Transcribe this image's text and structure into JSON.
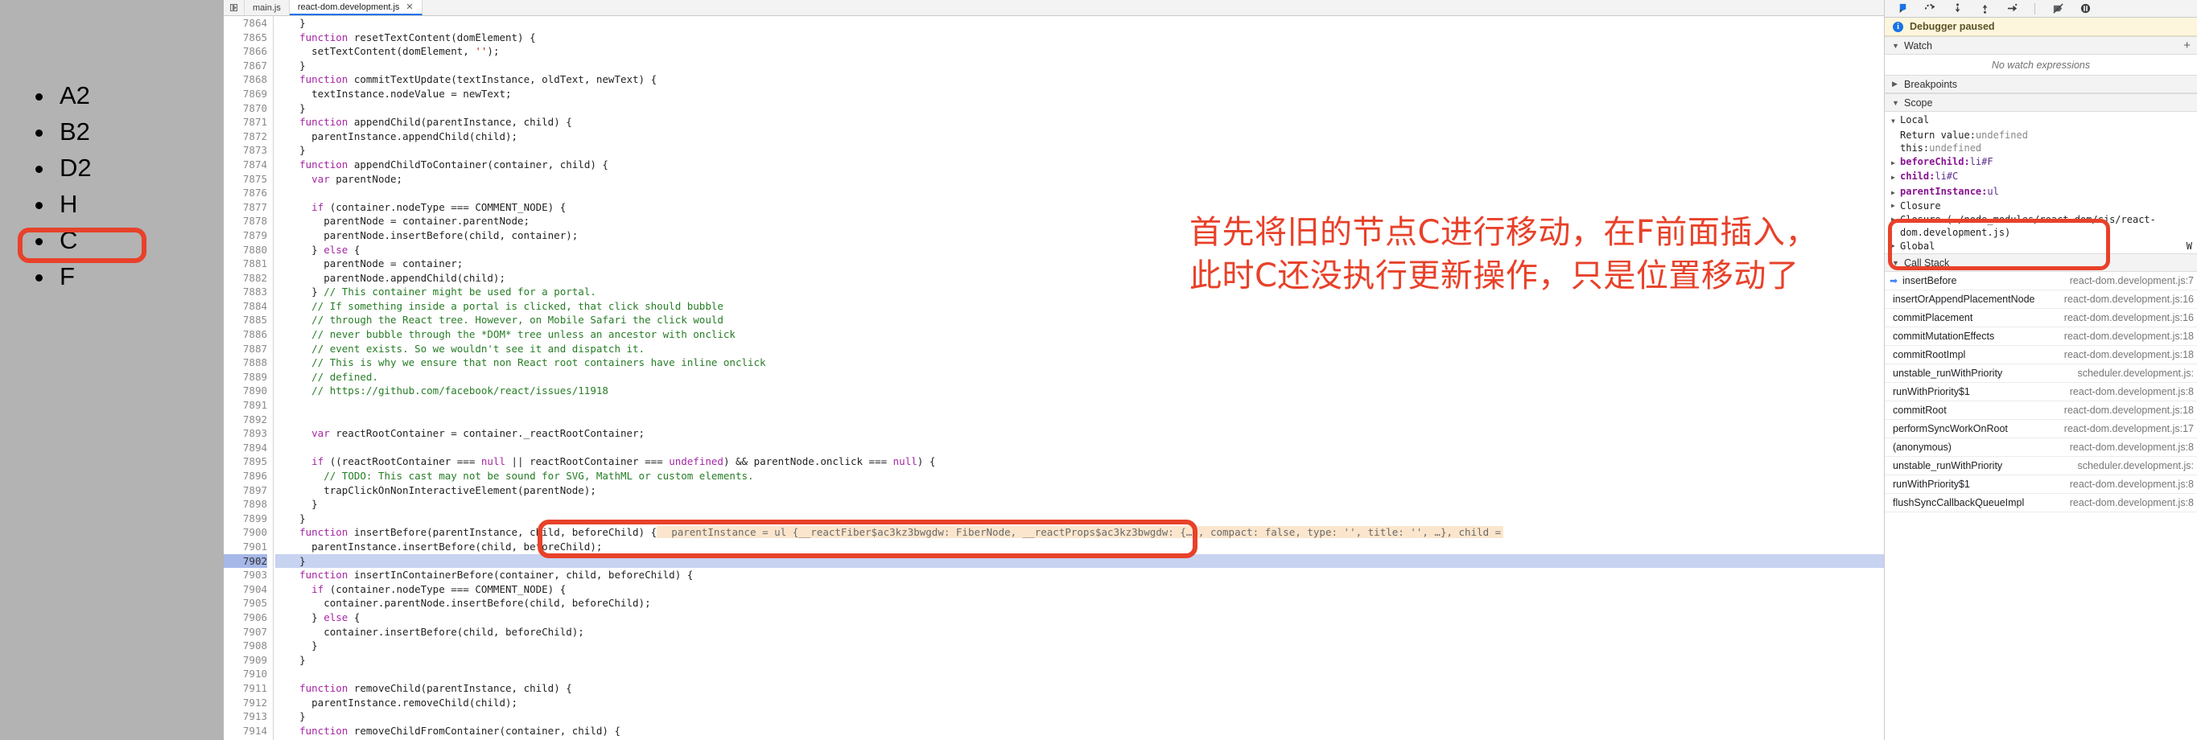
{
  "rendered_page": {
    "list_items": [
      {
        "label": "A2",
        "highlighted": false
      },
      {
        "label": "B2",
        "highlighted": false
      },
      {
        "label": "D2",
        "highlighted": false
      },
      {
        "label": "H",
        "highlighted": false
      },
      {
        "label": "C",
        "highlighted": true
      },
      {
        "label": "F",
        "highlighted": false
      }
    ]
  },
  "annotation": {
    "text": "首先将旧的节点C进行移动，在F前面插入，\n此时C还没执行更新操作，只是位置移动了",
    "color": "#e8412a"
  },
  "tabs": {
    "items": [
      {
        "label": "main.js",
        "active": false,
        "closable": false
      },
      {
        "label": "react-dom.development.js",
        "active": true,
        "closable": true
      }
    ],
    "close_glyph": "✕"
  },
  "editor": {
    "first_line": 7864,
    "current_line": 7902,
    "inline_eval": "parentInstance = ul {__reactFiber$ac3kz3bwgdw: FiberNode, __reactProps$ac3kz3bwgdw: {…}, compact: false, type: '', title: '', …}, child =",
    "lines": [
      {
        "n": 7864,
        "text": "    }"
      },
      {
        "n": 7865,
        "text": "    function resetTextContent(domElement) {"
      },
      {
        "n": 7866,
        "text": "      setTextContent(domElement, '');"
      },
      {
        "n": 7867,
        "text": "    }"
      },
      {
        "n": 7868,
        "text": "    function commitTextUpdate(textInstance, oldText, newText) {"
      },
      {
        "n": 7869,
        "text": "      textInstance.nodeValue = newText;"
      },
      {
        "n": 7870,
        "text": "    }"
      },
      {
        "n": 7871,
        "text": "    function appendChild(parentInstance, child) {"
      },
      {
        "n": 7872,
        "text": "      parentInstance.appendChild(child);"
      },
      {
        "n": 7873,
        "text": "    }"
      },
      {
        "n": 7874,
        "text": "    function appendChildToContainer(container, child) {"
      },
      {
        "n": 7875,
        "text": "      var parentNode;"
      },
      {
        "n": 7876,
        "text": ""
      },
      {
        "n": 7877,
        "text": "      if (container.nodeType === COMMENT_NODE) {"
      },
      {
        "n": 7878,
        "text": "        parentNode = container.parentNode;"
      },
      {
        "n": 7879,
        "text": "        parentNode.insertBefore(child, container);"
      },
      {
        "n": 7880,
        "text": "      } else {"
      },
      {
        "n": 7881,
        "text": "        parentNode = container;"
      },
      {
        "n": 7882,
        "text": "        parentNode.appendChild(child);"
      },
      {
        "n": 7883,
        "text": "      } // This container might be used for a portal."
      },
      {
        "n": 7884,
        "text": "      // If something inside a portal is clicked, that click should bubble"
      },
      {
        "n": 7885,
        "text": "      // through the React tree. However, on Mobile Safari the click would"
      },
      {
        "n": 7886,
        "text": "      // never bubble through the *DOM* tree unless an ancestor with onclick"
      },
      {
        "n": 7887,
        "text": "      // event exists. So we wouldn't see it and dispatch it."
      },
      {
        "n": 7888,
        "text": "      // This is why we ensure that non React root containers have inline onclick"
      },
      {
        "n": 7889,
        "text": "      // defined."
      },
      {
        "n": 7890,
        "text": "      // https://github.com/facebook/react/issues/11918"
      },
      {
        "n": 7891,
        "text": ""
      },
      {
        "n": 7892,
        "text": ""
      },
      {
        "n": 7893,
        "text": "      var reactRootContainer = container._reactRootContainer;"
      },
      {
        "n": 7894,
        "text": ""
      },
      {
        "n": 7895,
        "text": "      if ((reactRootContainer === null || reactRootContainer === undefined) && parentNode.onclick === null) {"
      },
      {
        "n": 7896,
        "text": "        // TODO: This cast may not be sound for SVG, MathML or custom elements."
      },
      {
        "n": 7897,
        "text": "        trapClickOnNonInteractiveElement(parentNode);"
      },
      {
        "n": 7898,
        "text": "      }"
      },
      {
        "n": 7899,
        "text": "    }"
      },
      {
        "n": 7900,
        "text": "    function insertBefore(parentInstance, child, beforeChild) {"
      },
      {
        "n": 7901,
        "text": "      parentInstance.insertBefore(child, beforeChild);"
      },
      {
        "n": 7902,
        "text": "    }"
      },
      {
        "n": 7903,
        "text": "    function insertInContainerBefore(container, child, beforeChild) {"
      },
      {
        "n": 7904,
        "text": "      if (container.nodeType === COMMENT_NODE) {"
      },
      {
        "n": 7905,
        "text": "        container.parentNode.insertBefore(child, beforeChild);"
      },
      {
        "n": 7906,
        "text": "      } else {"
      },
      {
        "n": 7907,
        "text": "        container.insertBefore(child, beforeChild);"
      },
      {
        "n": 7908,
        "text": "      }"
      },
      {
        "n": 7909,
        "text": "    }"
      },
      {
        "n": 7910,
        "text": ""
      },
      {
        "n": 7911,
        "text": "    function removeChild(parentInstance, child) {"
      },
      {
        "n": 7912,
        "text": "      parentInstance.removeChild(child);"
      },
      {
        "n": 7913,
        "text": "    }"
      },
      {
        "n": 7914,
        "text": "    function removeChildFromContainer(container, child) {"
      }
    ]
  },
  "debugger": {
    "toolbar_icons": [
      "resume-script-execution-icon",
      "step-over-next-function-call-icon",
      "step-into-next-function-call-icon",
      "step-out-of-current-function-icon",
      "step-icon",
      "deactivate-breakpoints-icon",
      "pause-on-exceptions-icon"
    ],
    "paused_banner": {
      "icon": "info-icon",
      "text": "Debugger paused"
    },
    "watch": {
      "title": "Watch",
      "add_label": "+",
      "empty_text": "No watch expressions",
      "expanded": true
    },
    "breakpoints": {
      "title": "Breakpoints",
      "expanded": false
    },
    "scope": {
      "title": "Scope",
      "expanded": true,
      "local_label": "Local",
      "entries": [
        {
          "name": "Return value",
          "value": "undefined",
          "expandable": false,
          "muted": true,
          "bold": false
        },
        {
          "name": "this",
          "value": "undefined",
          "expandable": false,
          "muted": true,
          "bold": false
        },
        {
          "name": "beforeChild",
          "value": "li#F",
          "expandable": true,
          "muted": false,
          "bold": true
        },
        {
          "name": "child",
          "value": "li#C",
          "expandable": true,
          "muted": false,
          "bold": true
        },
        {
          "name": "parentInstance",
          "value": "ul",
          "expandable": true,
          "muted": false,
          "bold": true
        }
      ],
      "groups": [
        {
          "label": "Closure",
          "badge": ""
        },
        {
          "label": "Closure (./node_modules/react-dom/cjs/react-dom.development.js)",
          "badge": ""
        },
        {
          "label": "Global",
          "badge": "W"
        }
      ]
    },
    "call_stack": {
      "title": "Call Stack",
      "expanded": true,
      "frames": [
        {
          "name": "insertBefore",
          "location": "react-dom.development.js:7",
          "active": true
        },
        {
          "name": "insertOrAppendPlacementNode",
          "location": "react-dom.development.js:16",
          "active": false
        },
        {
          "name": "commitPlacement",
          "location": "react-dom.development.js:16",
          "active": false
        },
        {
          "name": "commitMutationEffects",
          "location": "react-dom.development.js:18",
          "active": false
        },
        {
          "name": "commitRootImpl",
          "location": "react-dom.development.js:18",
          "active": false
        },
        {
          "name": "unstable_runWithPriority",
          "location": "scheduler.development.js:",
          "active": false
        },
        {
          "name": "runWithPriority$1",
          "location": "react-dom.development.js:8",
          "active": false
        },
        {
          "name": "commitRoot",
          "location": "react-dom.development.js:18",
          "active": false
        },
        {
          "name": "performSyncWorkOnRoot",
          "location": "react-dom.development.js:17",
          "active": false
        },
        {
          "name": "(anonymous)",
          "location": "react-dom.development.js:8",
          "active": false
        },
        {
          "name": "unstable_runWithPriority",
          "location": "scheduler.development.js:",
          "active": false
        },
        {
          "name": "runWithPriority$1",
          "location": "react-dom.development.js:8",
          "active": false
        },
        {
          "name": "flushSyncCallbackQueueImpl",
          "location": "react-dom.development.js:8",
          "active": false
        }
      ]
    }
  }
}
